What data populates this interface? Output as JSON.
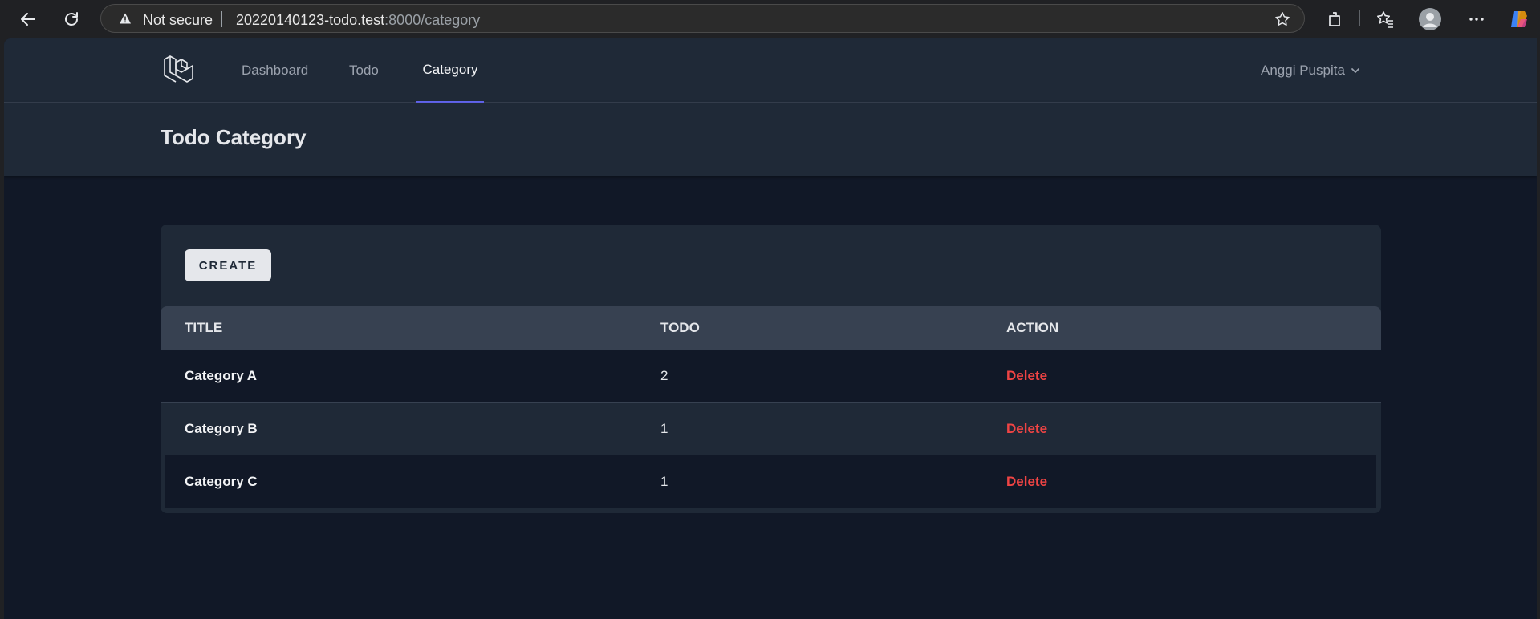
{
  "browser": {
    "security_label": "Not secure",
    "url_host": "20220140123-todo.test",
    "url_rest": ":8000/category"
  },
  "nav": {
    "items": [
      {
        "label": "Dashboard",
        "active": false
      },
      {
        "label": "Todo",
        "active": false
      },
      {
        "label": "Category",
        "active": true
      }
    ],
    "user_name": "Anggi Puspita",
    "accent_color": "#6366f1"
  },
  "header": {
    "title": "Todo Category"
  },
  "toolbar": {
    "create_label": "CREATE"
  },
  "table": {
    "columns": [
      "TITLE",
      "TODO",
      "ACTION"
    ],
    "rows": [
      {
        "title": "Category A",
        "todo": "2",
        "action": "Delete"
      },
      {
        "title": "Category B",
        "todo": "1",
        "action": "Delete"
      },
      {
        "title": "Category C",
        "todo": "1",
        "action": "Delete"
      }
    ]
  },
  "colors": {
    "page_bg": "#111827",
    "panel_bg": "#1f2937",
    "table_header_bg": "#374151",
    "delete_color": "#ef4444"
  },
  "icons": [
    "back-icon",
    "reload-icon",
    "warning-icon",
    "favorite-star-icon",
    "extensions-icon",
    "favorites-icon",
    "profile-icon",
    "more-icon",
    "copilot-icon",
    "laravel-logo-icon",
    "chevron-down-icon"
  ]
}
